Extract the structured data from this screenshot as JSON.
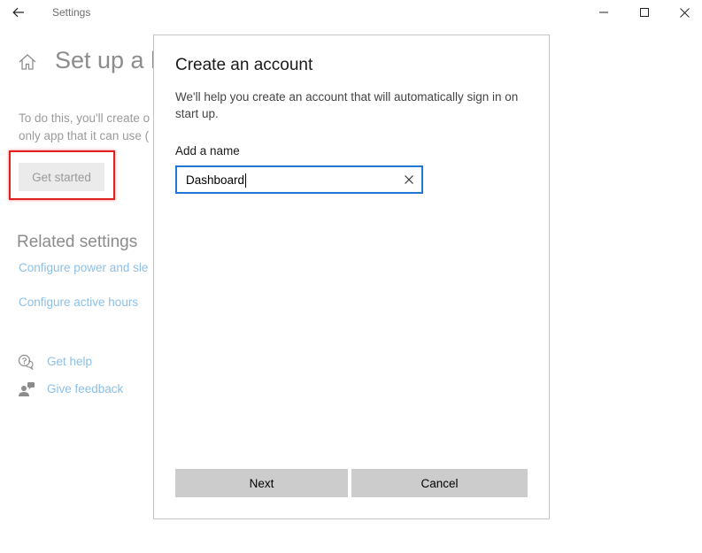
{
  "window": {
    "title": "Settings",
    "icons": {
      "back": "back-arrow-icon",
      "minimize": "minimize-icon",
      "maximize": "maximize-icon",
      "close": "close-icon"
    }
  },
  "background_page": {
    "title": "Set up a k",
    "description_line1": "To do this, you'll create o",
    "description_line2": "only app that it can use (",
    "get_started_label": "Get started",
    "related_heading": "Related settings",
    "links": {
      "power": "Configure power and sle",
      "hours": "Configure active hours",
      "help": "Get help",
      "feedback": "Give feedback"
    },
    "icons": {
      "home": "home-icon",
      "help": "help-chat-icon",
      "feedback": "feedback-person-icon"
    },
    "highlight_color": "#e02020"
  },
  "dialog": {
    "title": "Create an account",
    "description": "We'll help you create an account that will automatically sign in on start up.",
    "name_label": "Add a name",
    "name_value": "Dashboard",
    "clear_icon": "clear-x-icon",
    "next_label": "Next",
    "cancel_label": "Cancel",
    "accent_color": "#2078d4"
  }
}
